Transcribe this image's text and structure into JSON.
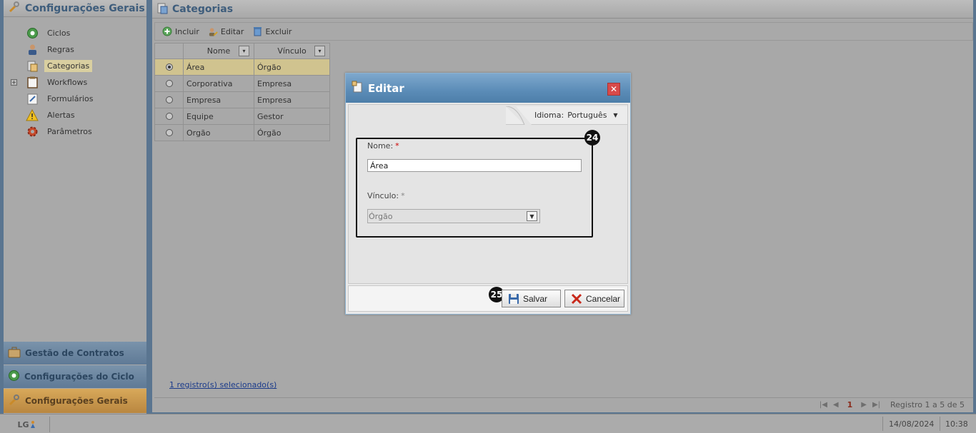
{
  "left_panel": {
    "title": "Configurações Gerais",
    "tree": [
      {
        "label": "Ciclos",
        "icon": "cycle-icon",
        "selected": false
      },
      {
        "label": "Regras",
        "icon": "user-rules-icon",
        "selected": false
      },
      {
        "label": "Categorias",
        "icon": "categories-icon",
        "selected": true
      },
      {
        "label": "Workflows",
        "icon": "workflow-icon",
        "selected": false,
        "expander": "+"
      },
      {
        "label": "Formulários",
        "icon": "form-icon",
        "selected": false
      },
      {
        "label": "Alertas",
        "icon": "warning-icon",
        "selected": false
      },
      {
        "label": "Parâmetros",
        "icon": "gear-icon",
        "selected": false
      }
    ],
    "accordion": [
      {
        "label": "Gestão de Contratos",
        "icon": "contracts-icon"
      },
      {
        "label": "Configurações do Ciclo",
        "icon": "cycle-config-icon"
      },
      {
        "label": "Configurações Gerais",
        "icon": "general-config-icon"
      }
    ]
  },
  "main": {
    "title": "Categorias",
    "toolbar": {
      "add_label": "Incluir",
      "edit_label": "Editar",
      "delete_label": "Excluir"
    },
    "grid": {
      "columns": [
        "Nome",
        "Vínculo"
      ],
      "rows": [
        {
          "nome": "Área",
          "vinculo": "Órgão",
          "selected": true
        },
        {
          "nome": "Corporativa",
          "vinculo": "Empresa",
          "selected": false
        },
        {
          "nome": "Empresa",
          "vinculo": "Empresa",
          "selected": false
        },
        {
          "nome": "Equipe",
          "vinculo": "Gestor",
          "selected": false
        },
        {
          "nome": "Orgão",
          "vinculo": "Órgão",
          "selected": false
        }
      ]
    },
    "selection_link": "1 registro(s) selecionado(s)",
    "pager": {
      "current_page": "1",
      "info": "Registro 1 a 5 de 5"
    }
  },
  "dialog": {
    "title": "Editar",
    "language_label": "Idioma:",
    "language_value": "Português",
    "nome_label": "Nome:",
    "nome_value": "Área",
    "vinculo_label": "Vínculo:",
    "vinculo_value": "Órgão",
    "required_mark": "*",
    "badge_form": "24",
    "badge_save": "25",
    "save_label": "Salvar",
    "cancel_label": "Cancelar"
  },
  "statusbar": {
    "logo": "LG",
    "date": "14/08/2024",
    "time": "10:38"
  }
}
